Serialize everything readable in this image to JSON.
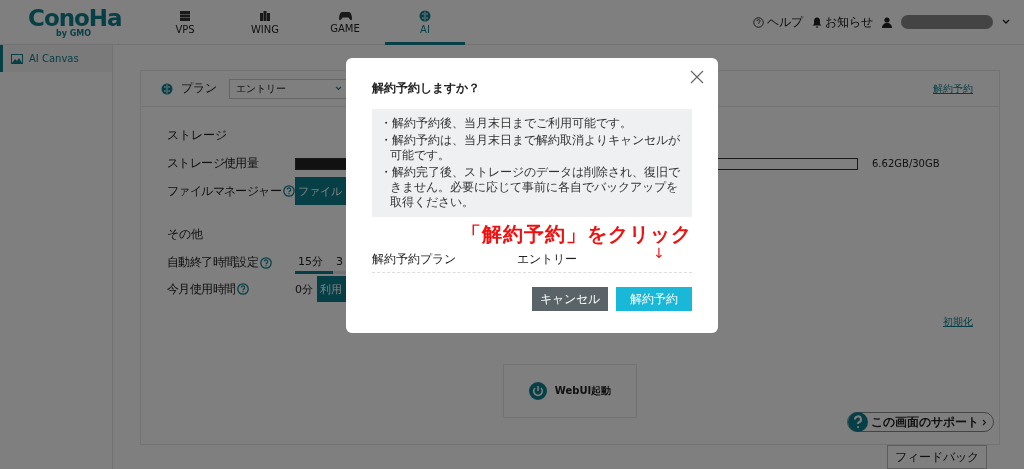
{
  "header": {
    "logo": "ConoHa",
    "logo_sub": "by GMO",
    "nav": [
      {
        "label": "VPS",
        "selected": false
      },
      {
        "label": "WING",
        "selected": false
      },
      {
        "label": "GAME",
        "selected": false
      },
      {
        "label": "AI",
        "selected": true
      }
    ],
    "help": "ヘルプ",
    "notifications": "お知らせ"
  },
  "sidebar": {
    "items": [
      {
        "label": "AI Canvas",
        "selected": true
      }
    ]
  },
  "plan": {
    "label": "プラン",
    "value": "エントリー",
    "cancel_link": "解約予約"
  },
  "storage": {
    "title": "ストレージ",
    "usage_label": "ストレージ使用量",
    "level": 0.22,
    "reading": "6.62GB/30GB",
    "file_manager_label": "ファイルマネージャー",
    "file_manager_button": "ファイル"
  },
  "other": {
    "title": "その他",
    "auto_stop_label": "自動終了時間設定",
    "auto_stop_tabs": [
      {
        "label": "15分",
        "selected": true
      },
      {
        "label": "3",
        "selected": false
      }
    ],
    "usage_label": "今月使用時間",
    "usage_value": "0分",
    "usage_button": "利用",
    "reset_link": "初期化"
  },
  "launch_button": "WebUI起動",
  "support": "この画面のサポート",
  "feedback": "フィードバック",
  "dialog": {
    "title": "解約予約しますか？",
    "notes": [
      "・解約予約後、当月末日までご利用可能です。",
      "・解約予約は、当月末日まで解約取消よりキャンセルが可能です。",
      "・解約完了後、ストレージのデータは削除され、復旧できません。必要に応じて事前に各自でバックアップを取得ください。"
    ],
    "plan_label": "解約予約プラン",
    "plan_value": "エントリー",
    "buttons": [
      {
        "label": "キャンセル",
        "kind": "secondary"
      },
      {
        "label": "解約予約",
        "kind": "primary"
      }
    ]
  },
  "annotation": {
    "text": "「解約予約」をクリック",
    "arrow": "↓"
  }
}
